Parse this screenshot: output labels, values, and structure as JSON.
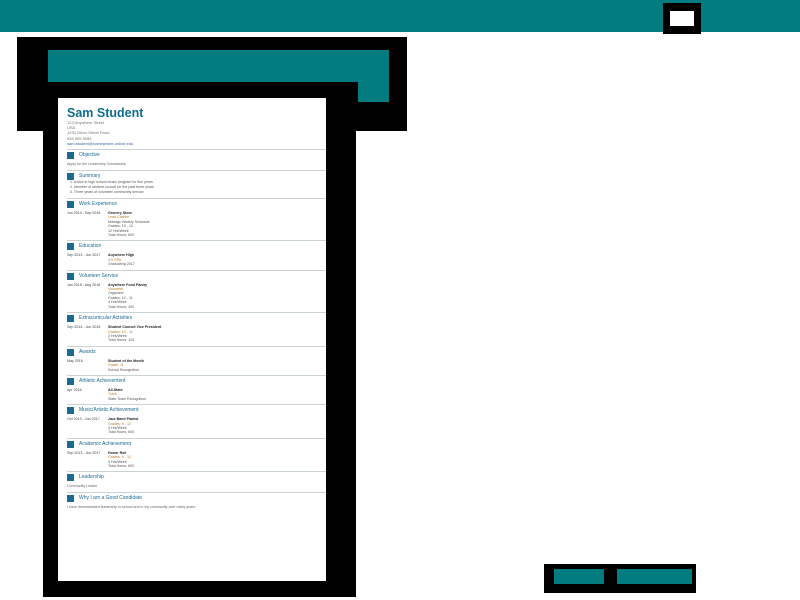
{
  "colors": {
    "accent": "#037c7f",
    "doc_heading": "#0d6f8f",
    "section": "#1c6a92"
  },
  "doc": {
    "name": "Sam Student",
    "contact": [
      "123 Anywhere Street",
      "USA",
      "1234 Other Street Road",
      "555 555 5555",
      "sam.student@somewhere-online.edu"
    ],
    "sections": [
      {
        "id": "objective",
        "icon": "target-icon",
        "label": "Objective",
        "text": "Apply for the Leadership Scholarship"
      },
      {
        "id": "summary",
        "icon": "summary-icon",
        "label": "Summary",
        "items": [
          "1. Active in high school music program for five years",
          "2. Member of student council for the past three years",
          "3. Three years of volunteer community service"
        ]
      },
      {
        "id": "work-experience",
        "icon": "briefcase-icon",
        "label": "Work Experience",
        "entries": [
          {
            "date": "Jun 2014 - Sep 2016",
            "title": "Grocery Store",
            "lines": [
              "Lead Cashier",
              "Manage Weekly Schedule",
              "Grades: 10 - 12",
              "12 Hrs/Week",
              "Total Hours: 600"
            ]
          }
        ]
      },
      {
        "id": "education",
        "icon": "graduation-cap-icon",
        "label": "Education",
        "entries": [
          {
            "date": "Sep 2013 - Jun 2017",
            "title": "Anywhere High",
            "lines": [
              "4.0 GPA",
              "Graduating 2017"
            ]
          }
        ]
      },
      {
        "id": "volunteer-service",
        "icon": "volunteer-icon",
        "label": "Volunteer Service",
        "entries": [
          {
            "date": "Jan 2015 - Aug 2016",
            "title": "Anywhere Food Pantry",
            "lines": [
              "Volunteer",
              "Organizer",
              "Grades: 10 - 11",
              "4 Hrs/Week",
              "Total Hours: 300"
            ]
          }
        ]
      },
      {
        "id": "extracurricular",
        "icon": "activity-icon",
        "label": "Extracurricular Activities",
        "entries": [
          {
            "date": "Sep 2014 - Jun 2016",
            "title": "Student Council Vice President",
            "lines": [
              "Grades: 10 - 11",
              "2 Hrs/Week",
              "Total Hours: 120"
            ]
          }
        ]
      },
      {
        "id": "awards",
        "icon": "award-icon",
        "label": "Awards",
        "entries": [
          {
            "date": "May 2016",
            "title": "Student of the Month",
            "lines": [
              "Grade: 11",
              "School Recognition"
            ]
          }
        ]
      },
      {
        "id": "athletic-achievement",
        "icon": "trophy-icon",
        "label": "Athletic Achievement",
        "entries": [
          {
            "date": "Apr 2016",
            "title": "All-State",
            "lines": [
              "Track",
              "State Team Recognition"
            ]
          }
        ]
      },
      {
        "id": "music-arts",
        "icon": "music-icon",
        "label": "Music/Artistic Achievement",
        "entries": [
          {
            "date": "Oct 2013 - Jun 2017",
            "title": "Jazz Band Pianist",
            "lines": [
              "Grades: 9 - 12",
              "4 Hrs/Week",
              "Total Hours: 600"
            ]
          }
        ]
      },
      {
        "id": "academic-achievement",
        "icon": "book-icon",
        "label": "Academic Achievement",
        "entries": [
          {
            "date": "Sep 2013 - Jun 2017",
            "title": "Honor Roll",
            "lines": [
              "Grades: 9 - 12",
              "4 Hrs/Week",
              "Total Hours: 600"
            ]
          }
        ]
      },
      {
        "id": "leadership",
        "icon": "leadership-icon",
        "label": "Leadership",
        "text": "Community Leader"
      },
      {
        "id": "why-scholarship",
        "icon": "question-icon",
        "label": "Why I am a Good Candidate",
        "text": "I have demonstrated leadership in school and in my community over many years."
      }
    ]
  },
  "buttons": {
    "back": "",
    "submit": ""
  }
}
